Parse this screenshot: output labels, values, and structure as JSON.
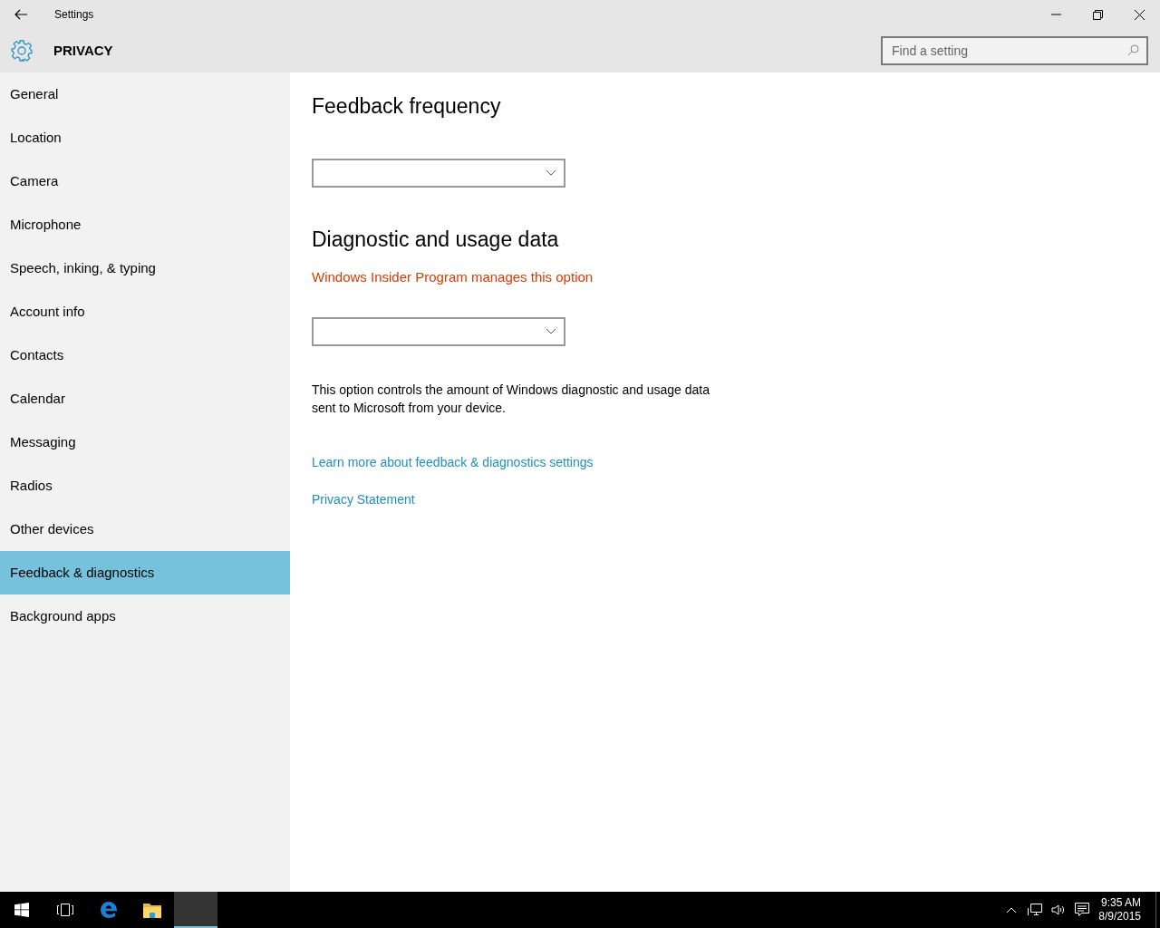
{
  "window": {
    "title": "Settings"
  },
  "header": {
    "title": "PRIVACY"
  },
  "search": {
    "placeholder": "Find a setting"
  },
  "sidebar": {
    "items": [
      {
        "label": "General",
        "selected": false
      },
      {
        "label": "Location",
        "selected": false
      },
      {
        "label": "Camera",
        "selected": false
      },
      {
        "label": "Microphone",
        "selected": false
      },
      {
        "label": "Speech, inking, & typing",
        "selected": false
      },
      {
        "label": "Account info",
        "selected": false
      },
      {
        "label": "Contacts",
        "selected": false
      },
      {
        "label": "Calendar",
        "selected": false
      },
      {
        "label": "Messaging",
        "selected": false
      },
      {
        "label": "Radios",
        "selected": false
      },
      {
        "label": "Other devices",
        "selected": false
      },
      {
        "label": "Feedback & diagnostics",
        "selected": true
      },
      {
        "label": "Background apps",
        "selected": false
      }
    ]
  },
  "content": [
    {
      "kind": "heading",
      "text": "Feedback frequency"
    },
    {
      "kind": "dropdown",
      "disabled": false
    },
    {
      "kind": "heading",
      "text": "Diagnostic and usage data"
    },
    {
      "kind": "warning",
      "text": "Windows Insider Program manages this option"
    },
    {
      "kind": "dropdown",
      "disabled": false
    },
    {
      "kind": "paragraph",
      "text": "This option controls the amount of Windows diagnostic and usage data sent to Microsoft from your device."
    },
    {
      "kind": "link",
      "text": "Learn more about feedback & diagnostics settings"
    },
    {
      "kind": "link",
      "text": "Privacy Statement"
    }
  ],
  "taskbar": {
    "apps": [
      {
        "kind": "start",
        "selected": false
      },
      {
        "kind": "taskview",
        "selected": false
      },
      {
        "kind": "browser",
        "selected": false
      },
      {
        "kind": "explorer",
        "selected": false
      },
      {
        "kind": "blank",
        "selected": true
      }
    ],
    "time": "9:35 AM",
    "date": "8/9/2015"
  }
}
